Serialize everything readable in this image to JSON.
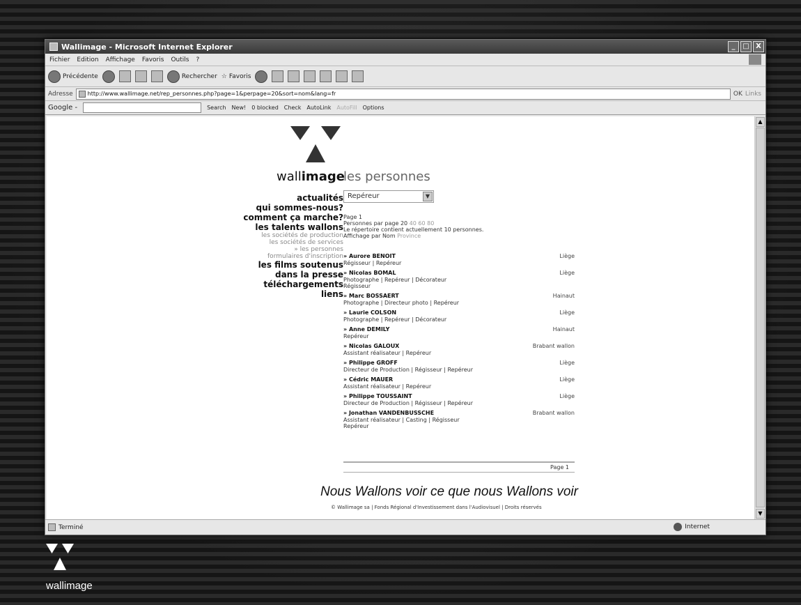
{
  "window": {
    "title": "Wallimage - Microsoft Internet Explorer",
    "min": "_",
    "max": "□",
    "close": "X"
  },
  "menubar": [
    "Fichier",
    "Edition",
    "Affichage",
    "Favoris",
    "Outils",
    "?"
  ],
  "toolbar": {
    "back": "Précédente",
    "search": "Rechercher",
    "favorites": "Favoris"
  },
  "address": {
    "label": "Adresse",
    "url": "http://www.wallimage.net/rep_personnes.php?page=1&perpage=20&sort=nom&lang=fr",
    "go": "OK",
    "links": "Links"
  },
  "googlebar": {
    "label": "Google -",
    "search": "Search",
    "new": "New!",
    "blocked": "0 blocked",
    "check": "Check",
    "autolink": "AutoLink",
    "autofill": "AutoFill",
    "options": "Options"
  },
  "page": {
    "brand_light": "wall",
    "brand_bold": "image",
    "title": "les personnes",
    "select_value": "Repéreur",
    "nav": [
      {
        "label": "actualités",
        "type": "main"
      },
      {
        "label": "qui sommes-nous?",
        "type": "main"
      },
      {
        "label": "comment ça marche?",
        "type": "main"
      },
      {
        "label": "les talents wallons",
        "type": "main"
      },
      {
        "label": "les sociétés de production",
        "type": "sub"
      },
      {
        "label": "les sociétés de services",
        "type": "sub"
      },
      {
        "label": "» les personnes",
        "type": "sub"
      },
      {
        "label": "formulaires d'inscription",
        "type": "sub"
      },
      {
        "label": "les films soutenus",
        "type": "main"
      },
      {
        "label": "dans la presse",
        "type": "main"
      },
      {
        "label": "téléchargements",
        "type": "main"
      },
      {
        "label": "liens",
        "type": "main"
      }
    ],
    "info": {
      "page": "Page  1",
      "perpage_label": "Personnes par page",
      "perpage_current": "20",
      "perpage_options": [
        "40",
        "60",
        "80"
      ],
      "count": "Le répertoire contient actuellement 10 personnes.",
      "sort_label": "Affichage par",
      "sort_current": "Nom",
      "sort_other": "Province"
    },
    "people": [
      {
        "name": "» Aurore BENOIT",
        "province": "Liège",
        "roles": [
          "Régisseur | Repéreur"
        ]
      },
      {
        "name": "» Nicolas BOMAL",
        "province": "Liège",
        "roles": [
          "Photographe | Repéreur | Décorateur",
          "Régisseur"
        ]
      },
      {
        "name": "» Marc BOSSAERT",
        "province": "Hainaut",
        "roles": [
          "Photographe | Directeur photo | Repéreur"
        ]
      },
      {
        "name": "» Laurie COLSON",
        "province": "Liège",
        "roles": [
          "Photographe | Repéreur | Décorateur"
        ]
      },
      {
        "name": "» Anne DEMILY",
        "province": "Hainaut",
        "roles": [
          "Repéreur"
        ]
      },
      {
        "name": "» Nicolas GALOUX",
        "province": "Brabant wallon",
        "roles": [
          "Assistant réalisateur | Repéreur"
        ]
      },
      {
        "name": "» Philippe GROFF",
        "province": "Liège",
        "roles": [
          "Directeur de Production | Régisseur | Repéreur"
        ]
      },
      {
        "name": "» Cédric MAUER",
        "province": "Liège",
        "roles": [
          "Assistant réalisateur | Repéreur"
        ]
      },
      {
        "name": "» Philippe TOUSSAINT",
        "province": "Liège",
        "roles": [
          "Directeur de Production | Régisseur | Repéreur"
        ]
      },
      {
        "name": "» Jonathan VANDENBUSSCHE",
        "province": "Brabant wallon",
        "roles": [
          "Assistant réalisateur | Casting | Régisseur",
          "Repéreur"
        ]
      }
    ],
    "pager": "Page  1",
    "slogan": "Nous Wallons voir ce que nous Wallons voir",
    "copyright": "© Wallimage sa  |  Fonds Régional d'Investissement dans l'Audiovisuel  |  Droits réservés"
  },
  "status": {
    "left": "Terminé",
    "zone": "Internet"
  },
  "corner_logo": {
    "word": "wallimage"
  }
}
